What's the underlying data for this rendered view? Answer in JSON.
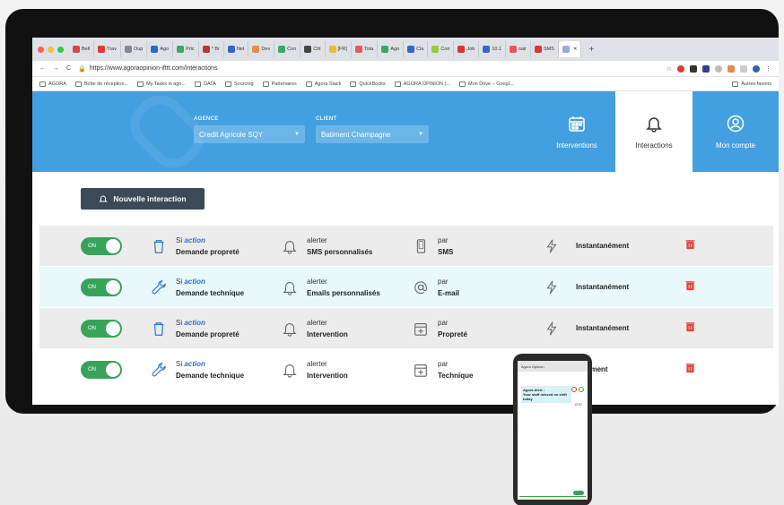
{
  "browser": {
    "tabs": [
      "Bell",
      "Trav",
      "Oup",
      "Ago",
      "Pric",
      "* Br",
      "Net",
      "Dev",
      "Con",
      "Chl",
      "[FR]",
      "Tota",
      "Ago",
      "Cla",
      "Con",
      "Job",
      "10.1",
      "sair",
      "SMS"
    ],
    "active_tab": "",
    "url": "https://www.agoraopinion-ifttt.com/interactions",
    "bookmarks": [
      "AGORA",
      "Boîte de réception...",
      "My Tasks in ago...",
      "DATA",
      "Sourcing",
      "Partenaires",
      "Agora Slack",
      "QuickBooks",
      "AGORA OPINION (...",
      "Mon Drive – Googl..."
    ],
    "other_bookmarks": "Autres favoris"
  },
  "header": {
    "agence_label": "AGENCE",
    "agence_value": "Credit Agricole SQY",
    "client_label": "CLIENT",
    "client_value": "Batiment Champagne",
    "tabs": [
      {
        "label": "Interventions",
        "icon": "calendar-icon"
      },
      {
        "label": "Interactions",
        "icon": "bell-icon"
      },
      {
        "label": "Mon compte",
        "icon": "user-icon"
      }
    ]
  },
  "new_button": "Nouvelle interaction",
  "rows": [
    {
      "toggle": "ON",
      "si": "Si",
      "action": "action",
      "trigger": "Demande propreté",
      "trigger_icon": "trash-can-icon",
      "alert_label": "alerter",
      "alert": "SMS personnalisés",
      "par_label": "par",
      "channel": "SMS",
      "channel_icon": "phone-icon",
      "timing": "Instantanément"
    },
    {
      "toggle": "ON",
      "si": "Si",
      "action": "action",
      "trigger": "Demande technique",
      "trigger_icon": "wrench-icon",
      "alert_label": "alerter",
      "alert": "Emails personnalisés",
      "par_label": "par",
      "channel": "E-mail",
      "channel_icon": "at-icon",
      "timing": "Instantanément"
    },
    {
      "toggle": "ON",
      "si": "Si",
      "action": "action",
      "trigger": "Demande propreté",
      "trigger_icon": "trash-can-icon",
      "alert_label": "alerter",
      "alert": "Intervention",
      "par_label": "par",
      "channel": "Propreté",
      "channel_icon": "calendar-plus-icon",
      "timing": "Instantanément"
    },
    {
      "toggle": "ON",
      "si": "Si",
      "action": "action",
      "trigger": "Demande technique",
      "trigger_icon": "wrench-icon",
      "alert_label": "alerter",
      "alert": "Intervention",
      "par_label": "par",
      "channel": "Technique",
      "channel_icon": "calendar-plus-icon",
      "timing": "tanément"
    }
  ],
  "phone": {
    "header": "Agora Opinion",
    "notif_title": "Agora Alert :",
    "notif_body": "Your staff missed on shift today",
    "time": "12:57"
  },
  "colors": {
    "header_blue": "#43a0e0",
    "toggle_green": "#37a35a",
    "delete_red": "#e0463c",
    "button_dark": "#3b4a56"
  }
}
